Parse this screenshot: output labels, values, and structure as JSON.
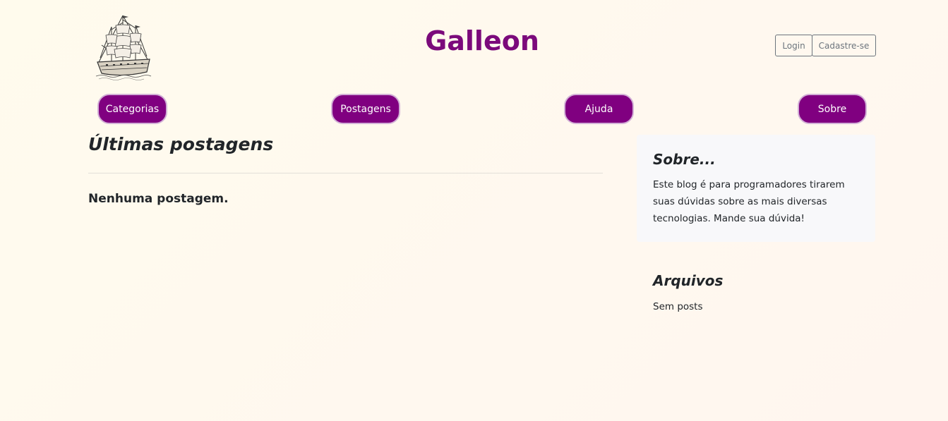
{
  "header": {
    "logo_alt": "galleon-ship-icon",
    "title": "Galleon",
    "title_color": "#7b0a7b",
    "login_label": "Login",
    "register_label": "Cadastre-se"
  },
  "nav": {
    "accent": "#800080",
    "items": [
      {
        "label": "Categorias"
      },
      {
        "label": "Postagens"
      },
      {
        "label": "Ajuda"
      },
      {
        "label": "Sobre"
      }
    ]
  },
  "main": {
    "heading": "Últimas postagens",
    "empty_message": "Nenhuma postagem."
  },
  "sidebar": {
    "about": {
      "title": "Sobre...",
      "text": "Este blog é para programadores tirarem suas dúvidas sobre as mais diversas tecnologias. Mande sua dúvida!"
    },
    "archives": {
      "title": "Arquivos",
      "text": "Sem posts"
    }
  }
}
